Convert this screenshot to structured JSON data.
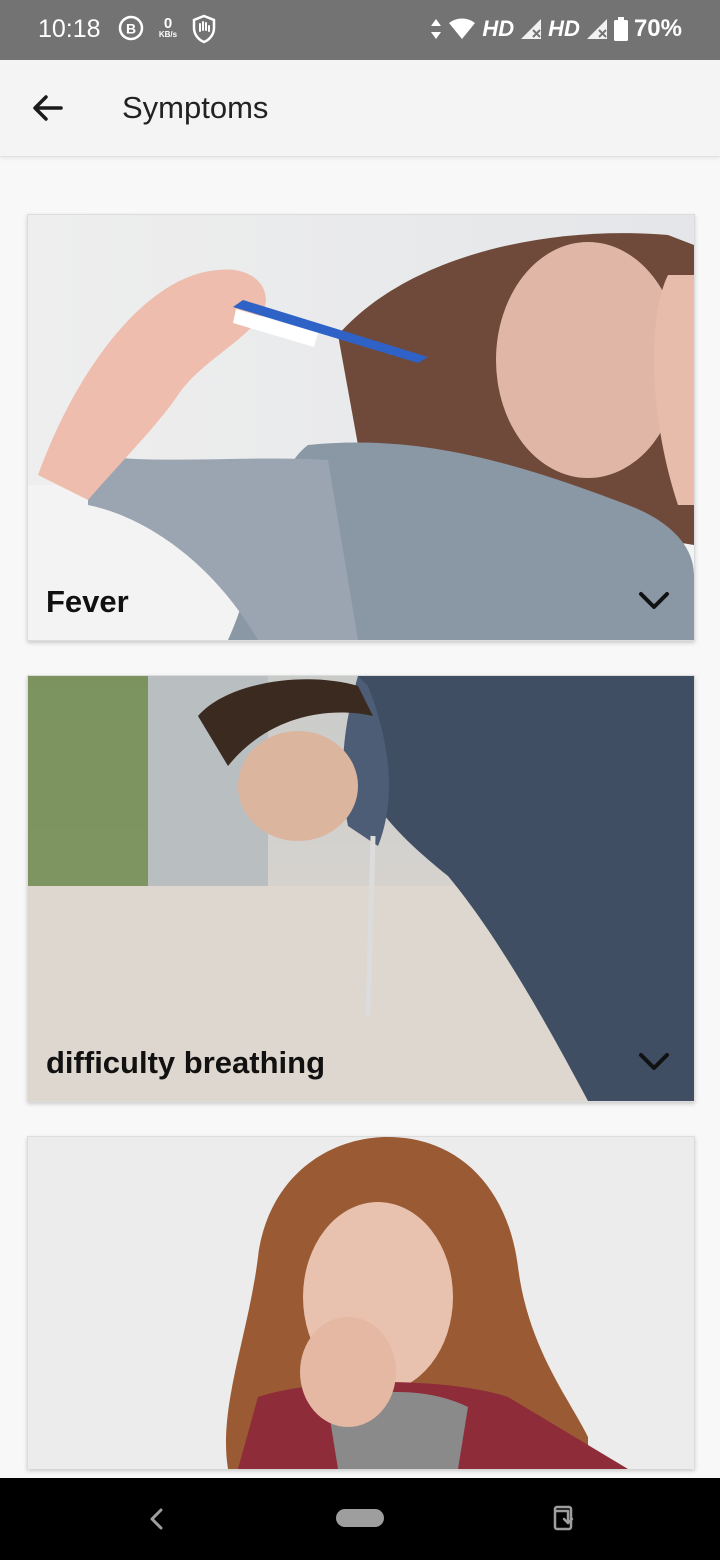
{
  "status_bar": {
    "time": "10:18",
    "data_speed_value": "0",
    "data_speed_unit": "KB/s",
    "network_label_1": "HD",
    "network_label_2": "HD",
    "battery": "70%",
    "icons": [
      "b-badge-icon",
      "data-speed-icon",
      "shield-hand-icon",
      "data-arrows-icon",
      "wifi-icon",
      "signal-icon",
      "signal-icon",
      "battery-icon"
    ]
  },
  "app_bar": {
    "title": "Symptoms",
    "back_icon": "arrow-left-icon"
  },
  "symptoms": [
    {
      "label": "Fever",
      "image": "woman-with-thermometer-photo",
      "icon": "chevron-down-icon"
    },
    {
      "label": "difficulty breathing",
      "image": "woman-bent-over-breathless-photo",
      "icon": "chevron-down-icon"
    },
    {
      "label": "",
      "image": "woman-coughing-photo"
    }
  ],
  "nav_bar": {
    "icons": [
      "nav-back-icon",
      "nav-home-pill",
      "rotate-screen-icon"
    ]
  }
}
